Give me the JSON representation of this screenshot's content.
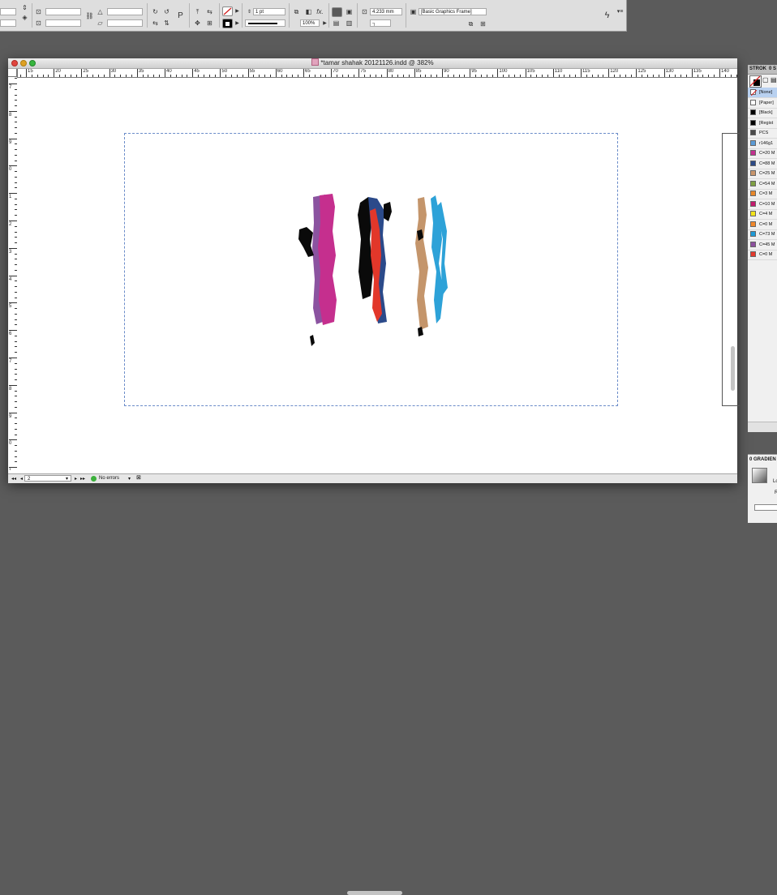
{
  "control_bar": {
    "stroke_weight": "1 pt",
    "zoom_percent": "100%",
    "offset_value": "4.233 mm",
    "object_style": "[Basic Graphics Frame]",
    "type_tool_glyph": "P",
    "fx_glyph": "fx."
  },
  "document": {
    "title": "*tamar shahak 20121126.indd @ 382%",
    "ruler_h": [
      "15",
      "20",
      "25",
      "30",
      "35",
      "40",
      "45",
      "50",
      "55",
      "60",
      "65",
      "70",
      "75",
      "80",
      "85",
      "90",
      "95",
      "100",
      "105",
      "110",
      "115",
      "120",
      "125",
      "130",
      "135",
      "140"
    ],
    "ruler_v": [
      "7",
      "8",
      "9",
      "0",
      "1",
      "2",
      "3",
      "4",
      "5",
      "6",
      "7",
      "8",
      "9",
      "0",
      "1"
    ],
    "page_number": "2",
    "preflight_status": "No errors"
  },
  "swatches_panel": {
    "tab_label": "STROK",
    "tab_label_2": "0 S",
    "swatches": [
      {
        "name": "[None]",
        "color": "#ffffff"
      },
      {
        "name": "[Paper]",
        "color": "#ffffff"
      },
      {
        "name": "[Black]",
        "color": "#000000"
      },
      {
        "name": "[Regist",
        "color": "#000000"
      },
      {
        "name": "PCS",
        "color": "#4a4a4a"
      },
      {
        "name": "r146g1",
        "color": "#5b9bd5"
      },
      {
        "name": "C=20 M",
        "color": "#c2318f"
      },
      {
        "name": "C=88 M",
        "color": "#2c4a86"
      },
      {
        "name": "C=25 M",
        "color": "#c8956b"
      },
      {
        "name": "C=54 M",
        "color": "#7fa043"
      },
      {
        "name": "C=3 M",
        "color": "#e8872a"
      },
      {
        "name": "C=10 M",
        "color": "#c21b6c"
      },
      {
        "name": "C=4 M",
        "color": "#f2e21a"
      },
      {
        "name": "C=0 M",
        "color": "#f0872b"
      },
      {
        "name": "C=73 M",
        "color": "#1f9ad6"
      },
      {
        "name": "C=45 M",
        "color": "#8c4f9e"
      },
      {
        "name": "C=0 M",
        "color": "#e33a2d"
      }
    ]
  },
  "gradient_panel": {
    "title": "0 GRADIEN",
    "label_1": "Lo",
    "label_2": "R"
  },
  "colors": {
    "magenta": "#c52f8e",
    "purple": "#8b53a0",
    "navy": "#2b4a8a",
    "red": "#e2372a",
    "tan": "#c4956b",
    "cyan": "#2da2d8",
    "black": "#0a0a0a"
  }
}
